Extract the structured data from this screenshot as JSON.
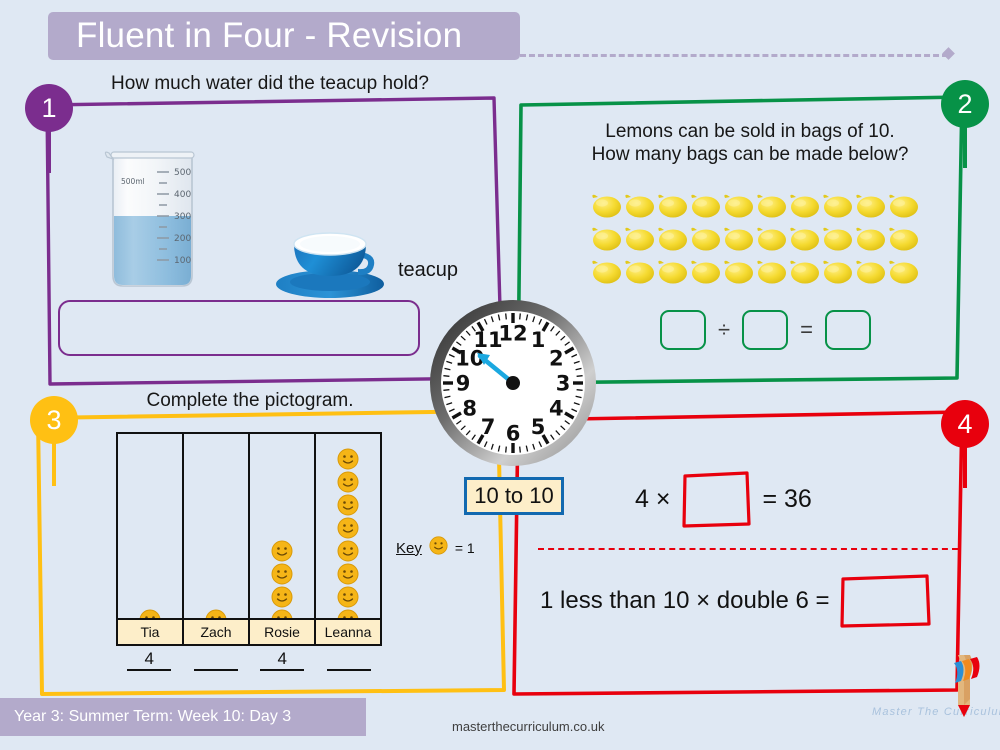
{
  "header": {
    "title": "Fluent in Four - Revision"
  },
  "questions": [
    {
      "number": "1",
      "color": "#7b2d8e",
      "prompt": "How much water did the teacup hold?",
      "beaker": {
        "capacity_label": "500ml",
        "tick_labels": [
          "500",
          "400",
          "300",
          "200",
          "100"
        ],
        "water_level_ml": 300
      },
      "object_label": "teacup",
      "answer_value": ""
    },
    {
      "number": "2",
      "color": "#079247",
      "prompt_line1": "Lemons can be sold in bags of 10.",
      "prompt_line2": "How many bags can be made below?",
      "lemon_rows": 3,
      "lemons_per_row": 10,
      "total_lemons": 30,
      "equation": {
        "box1": "",
        "operator": "÷",
        "box2": "",
        "equals": "=",
        "box3": ""
      }
    },
    {
      "number": "3",
      "color": "#ffc013",
      "prompt": "Complete the pictogram.",
      "pictogram": {
        "names": [
          "Tia",
          "Zach",
          "Rosie",
          "Leanna"
        ],
        "faces": [
          1,
          1,
          4,
          8
        ],
        "answers": [
          "4",
          "",
          "4",
          ""
        ],
        "key_label": "Key",
        "key_value": "= 1"
      }
    },
    {
      "number": "4",
      "color": "#e8000d",
      "line1": {
        "prefix": "4 ×",
        "box": "",
        "suffix": "= 36"
      },
      "line2": {
        "prefix": "1 less than 10 × double 6 =",
        "box": ""
      }
    }
  ],
  "clock": {
    "numerals": [
      "12",
      "1",
      "2",
      "3",
      "4",
      "5",
      "6",
      "7",
      "8",
      "9",
      "10",
      "11"
    ],
    "hand_points_to": 10,
    "answer_label": "10 to 10",
    "hand_color": "#1ba8e0"
  },
  "footer": {
    "term_info": "Year 3: Summer Term: Week 10: Day 3",
    "website": "masterthecurriculum.co.uk",
    "brand": "Master The Curriculum"
  }
}
